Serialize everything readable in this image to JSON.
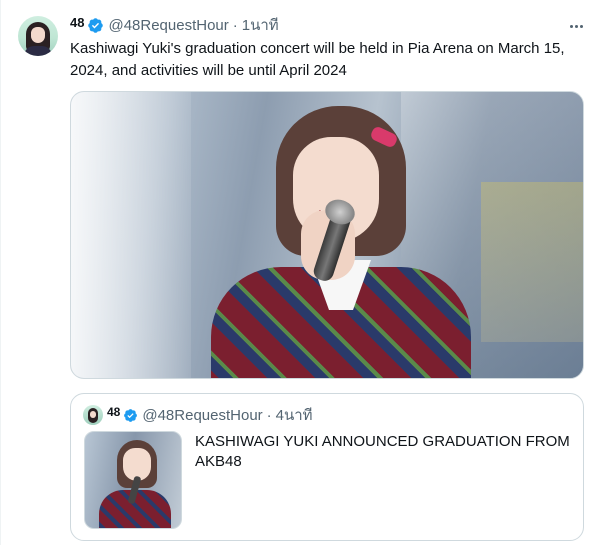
{
  "tweet": {
    "display_name": "48",
    "handle": "@48RequestHour",
    "separator": "·",
    "time": "1นาที",
    "text": "Kashiwagi Yuki's graduation concert will be held in Pia Arena on March 15, 2024, and activities will be until April 2024"
  },
  "quoted_tweet": {
    "display_name": "48",
    "handle": "@48RequestHour",
    "separator": "·",
    "time": "4นาที",
    "text": "KASHIWAGI YUKI ANNOUNCED GRADUATION FROM AKB48"
  },
  "colors": {
    "verified": "#1d9bf0",
    "secondary_text": "#536471",
    "border": "#cfd9de"
  },
  "icons": {
    "verified": "verified-badge-icon",
    "more": "more-options-icon"
  }
}
